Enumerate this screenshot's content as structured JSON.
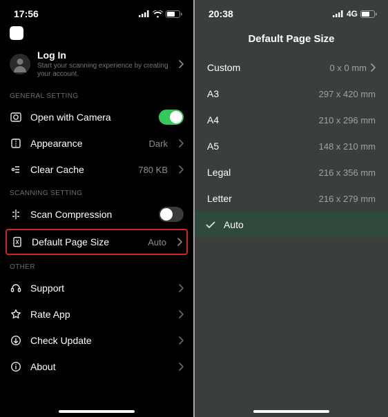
{
  "left": {
    "status": {
      "time": "17:56"
    },
    "login": {
      "title": "Log In",
      "subtitle": "Start your scanning experience by creating your account."
    },
    "sections": {
      "general": {
        "header": "GENERAL SETTING",
        "open_camera": "Open with Camera",
        "appearance": {
          "label": "Appearance",
          "value": "Dark"
        },
        "clear_cache": {
          "label": "Clear Cache",
          "value": "780 KB"
        }
      },
      "scanning": {
        "header": "SCANNING SETTING",
        "scan_compression": "Scan Compression",
        "default_page_size": {
          "label": "Default Page Size",
          "value": "Auto"
        }
      },
      "other": {
        "header": "OTHER",
        "support": "Support",
        "rate": "Rate App",
        "update": "Check Update",
        "about": "About"
      }
    }
  },
  "right": {
    "status": {
      "time": "20:38",
      "net": "4G"
    },
    "title": "Default Page Size",
    "options": {
      "custom": {
        "label": "Custom",
        "value": "0 x 0 mm"
      },
      "a3": {
        "label": "A3",
        "value": "297 x 420 mm"
      },
      "a4": {
        "label": "A4",
        "value": "210 x 296 mm"
      },
      "a5": {
        "label": "A5",
        "value": "148 x 210 mm"
      },
      "legal": {
        "label": "Legal",
        "value": "216 x 356 mm"
      },
      "letter": {
        "label": "Letter",
        "value": "216 x 279 mm"
      },
      "auto": {
        "label": "Auto"
      }
    },
    "selected": "auto"
  }
}
